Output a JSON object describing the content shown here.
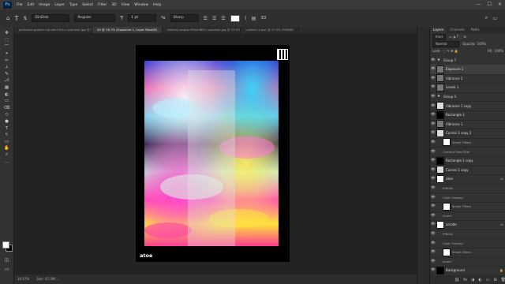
{
  "app": {
    "logo": "Ps"
  },
  "menu": [
    "File",
    "Edit",
    "Image",
    "Layer",
    "Type",
    "Select",
    "Filter",
    "3D",
    "View",
    "Window",
    "Help"
  ],
  "window_controls": [
    "—",
    "☐",
    "✕"
  ],
  "options_bar": {
    "font_family": "DinDisk",
    "font_style": "Regular",
    "font_size": "1 pt",
    "antialias": "Sharp"
  },
  "tabs": [
    {
      "label": "parkzone-golden-hip-hex7441c-unsplash.jpg @ 13.1% (Gradient Map 1 copy, RGB/8)",
      "active": false
    },
    {
      "label": "40 @ 16.7% (Exposure 1, Layer Mask/8)",
      "active": true
    },
    {
      "label": "dreamy-pages-f95cb4867-unsplash.jpg @ 33.3% (RGB/8)",
      "active": false
    },
    {
      "label": "untitled-1.psd @ 12.5% (RGB/8)",
      "active": false
    }
  ],
  "tools": [
    "✥",
    "⬚",
    "⌒",
    "⌖",
    "✂",
    "⟂",
    "✎",
    "⎇",
    "▦",
    "◐",
    "▭",
    "⌫",
    "◇",
    "●",
    "T",
    "↖",
    "▭",
    "✋",
    "⌕",
    "···"
  ],
  "artwork": {
    "brand_text": "atoe"
  },
  "status": {
    "zoom": "16.67%",
    "doc_size": "Doc: 47.3M/..."
  },
  "layers_panel": {
    "tabs": [
      {
        "label": "Layers",
        "active": true
      },
      {
        "label": "Channels",
        "active": false
      },
      {
        "label": "Paths",
        "active": false
      }
    ],
    "filter": "Kind",
    "blend_mode": "Normal",
    "opacity_label": "Opacity:",
    "opacity": "100%",
    "lock_label": "Lock:",
    "fill_label": "Fill:",
    "fill": "100%",
    "layers": [
      {
        "name": "Group 7",
        "kind": "folder",
        "eye": true,
        "selected": false
      },
      {
        "name": "Exposure 1",
        "kind": "adj",
        "eye": true,
        "selected": true
      },
      {
        "name": "Vibrance 2",
        "kind": "adj",
        "eye": true,
        "selected": false
      },
      {
        "name": "Levels 1",
        "kind": "adj",
        "eye": true,
        "selected": false
      },
      {
        "name": "Group 3",
        "kind": "folder",
        "eye": true,
        "selected": false
      },
      {
        "name": "Vibrance 1 copy",
        "kind": "img",
        "eye": true,
        "selected": false
      },
      {
        "name": "Rectangle 1",
        "kind": "black",
        "eye": true,
        "selected": false
      },
      {
        "name": "Vibrance 1",
        "kind": "adj",
        "eye": true,
        "selected": false
      },
      {
        "name": "Curves 1 copy 2",
        "kind": "img",
        "eye": true,
        "selected": false
      },
      {
        "name": "Smart Filters",
        "kind": "white",
        "eye": true,
        "selected": false,
        "sub": true
      },
      {
        "name": "Camera Raw Filter",
        "kind": "none",
        "eye": true,
        "selected": false,
        "sub": true
      },
      {
        "name": "Rectangle 1 copy",
        "kind": "black",
        "eye": true,
        "selected": false
      },
      {
        "name": "Curves 1 copy",
        "kind": "img",
        "eye": true,
        "selected": false
      },
      {
        "name": "atoe",
        "kind": "white",
        "eye": true,
        "selected": false,
        "fx": "fx"
      },
      {
        "name": "Effects",
        "kind": "none",
        "eye": true,
        "selected": false,
        "sub": true
      },
      {
        "name": "Color Overlay",
        "kind": "none",
        "eye": true,
        "selected": false,
        "sub": true
      },
      {
        "name": "Smart Filters",
        "kind": "white",
        "eye": true,
        "selected": false,
        "sub": true
      },
      {
        "name": "Invert",
        "kind": "none",
        "eye": true,
        "selected": false,
        "sub": true
      },
      {
        "name": "arcode",
        "kind": "white",
        "eye": true,
        "selected": false,
        "fx": "fx"
      },
      {
        "name": "Effects",
        "kind": "none",
        "eye": true,
        "selected": false,
        "sub": true
      },
      {
        "name": "Color Overlay",
        "kind": "none",
        "eye": true,
        "selected": false,
        "sub": true
      },
      {
        "name": "Smart Filters",
        "kind": "white",
        "eye": true,
        "selected": false,
        "sub": true
      },
      {
        "name": "Invert",
        "kind": "none",
        "eye": true,
        "selected": false,
        "sub": true
      },
      {
        "name": "Background",
        "kind": "black",
        "eye": true,
        "selected": false,
        "lock": "🔒"
      }
    ],
    "bottom_icons": [
      "⛓",
      "fx",
      "◑",
      "◐",
      "▭",
      "⊞",
      "🗑"
    ]
  }
}
